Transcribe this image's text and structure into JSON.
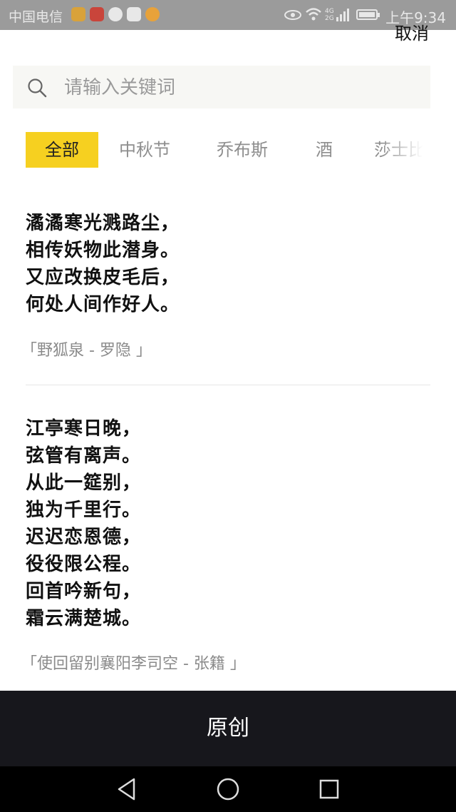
{
  "status_bar": {
    "carrier": "中国电信",
    "time": "上午9:34",
    "network": "4G 2G"
  },
  "header": {
    "cancel_label": "取消"
  },
  "search": {
    "placeholder": "请输入关键词"
  },
  "tabs": [
    {
      "label": "全部",
      "active": true
    },
    {
      "label": "中秋节",
      "active": false
    },
    {
      "label": "乔布斯",
      "active": false
    },
    {
      "label": "酒",
      "active": false
    },
    {
      "label": "莎士比",
      "active": false
    }
  ],
  "poems": [
    {
      "lines": [
        "潏潏寒光溅路尘，",
        "相传妖物此潜身。",
        "又应改换皮毛后，",
        "何处人间作好人。"
      ],
      "source": "「野狐泉 - 罗隐 」"
    },
    {
      "lines": [
        "江亭寒日晚，",
        "弦管有离声。",
        "从此一筵别，",
        "独为千里行。",
        "迟迟恋恩德，",
        "役役限公程。",
        "回首吟新句，",
        "霜云满楚城。"
      ],
      "source": "「使回留别襄阳李司空 - 张籍 」"
    }
  ],
  "bottom_bar": {
    "label": "原创"
  },
  "colors": {
    "accent": "#f6d020",
    "bottom_bar": "#17171c",
    "status_bar": "#9b9b9b"
  }
}
